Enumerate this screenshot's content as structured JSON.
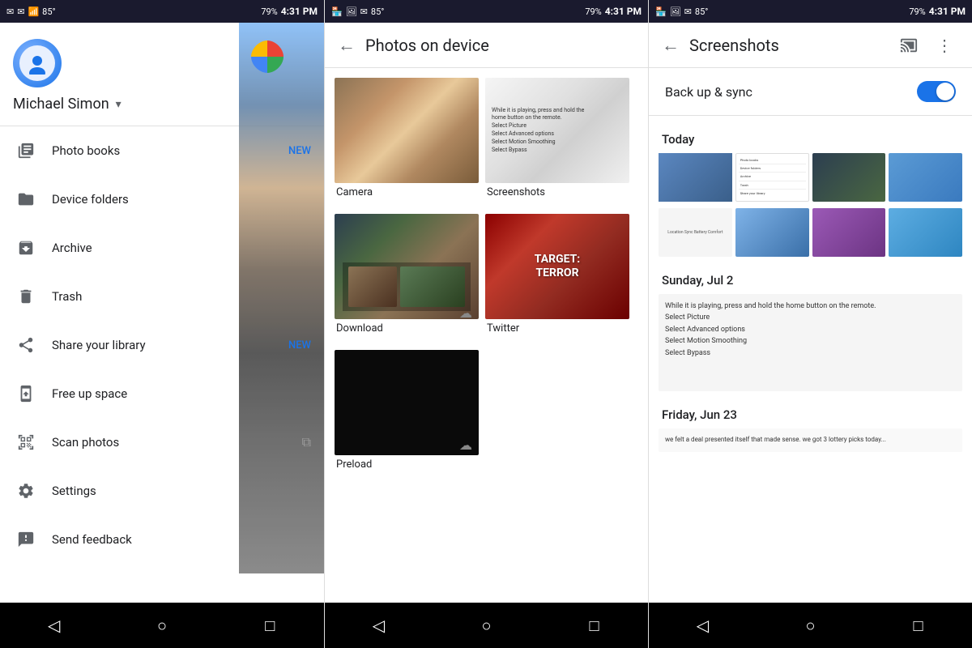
{
  "statusBar": {
    "time": "4:31 PM",
    "battery": "79%",
    "signal": "LTE"
  },
  "panel1": {
    "user": {
      "name": "Michael Simon"
    },
    "menuItems": [
      {
        "id": "photo-books",
        "label": "Photo books",
        "badge": "NEW",
        "icon": "book"
      },
      {
        "id": "device-folders",
        "label": "Device folders",
        "badge": "",
        "icon": "folder"
      },
      {
        "id": "archive",
        "label": "Archive",
        "badge": "",
        "icon": "archive"
      },
      {
        "id": "trash",
        "label": "Trash",
        "badge": "",
        "icon": "trash"
      },
      {
        "id": "share-library",
        "label": "Share your library",
        "badge": "NEW",
        "icon": "share"
      },
      {
        "id": "free-up-space",
        "label": "Free up space",
        "badge": "",
        "icon": "phone-download"
      },
      {
        "id": "scan-photos",
        "label": "Scan photos",
        "badge": "",
        "icon": "scan",
        "external": true
      },
      {
        "id": "settings",
        "label": "Settings",
        "badge": "",
        "icon": "gear"
      },
      {
        "id": "send-feedback",
        "label": "Send feedback",
        "badge": "",
        "icon": "feedback"
      }
    ]
  },
  "panel2": {
    "title": "Photos on device",
    "folders": [
      {
        "id": "camera",
        "label": "Camera",
        "type": "camera"
      },
      {
        "id": "screenshots",
        "label": "Screenshots",
        "type": "screenshots"
      },
      {
        "id": "download",
        "label": "Download",
        "type": "download"
      },
      {
        "id": "twitter",
        "label": "Twitter",
        "type": "twitter"
      },
      {
        "id": "preload",
        "label": "Preload",
        "type": "preload"
      }
    ]
  },
  "panel3": {
    "title": "Screenshots",
    "backupSync": "Back up & sync",
    "syncEnabled": true,
    "sections": [
      {
        "dateLabel": "Today",
        "items": []
      },
      {
        "dateLabel": "Sunday, Jul 2",
        "items": []
      },
      {
        "dateLabel": "Friday, Jun 23",
        "items": []
      }
    ],
    "sundayText": "While it is playing, press and hold the home button on the remote.\nSelect Picture\nSelect Advanced options\nSelect Motion Smoothing\nSelect Bypass",
    "fridayText": "we felt a deal presented itself that made sense. we got 3 lottery picks today..."
  },
  "navBar": {
    "back": "◁",
    "home": "○",
    "recent": "□"
  }
}
